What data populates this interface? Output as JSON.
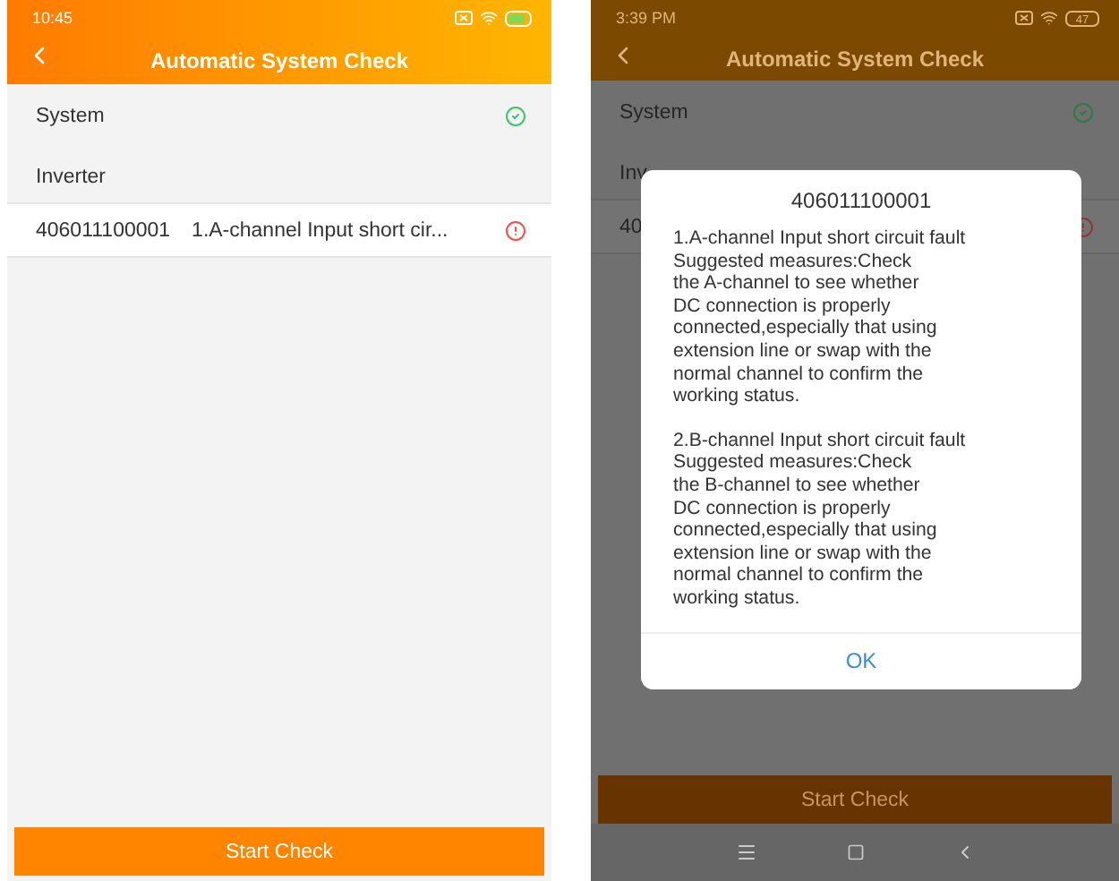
{
  "screens": [
    {
      "dimmed": false,
      "status_bar": {
        "time": "10:45"
      },
      "header": {
        "title": "Automatic System Check"
      },
      "rows": [
        {
          "kind": "status",
          "label": "System",
          "passed": true
        },
        {
          "kind": "section",
          "label": "Inverter"
        },
        {
          "kind": "fault",
          "code": "406011100001",
          "message": "1.A-channel Input short cir...",
          "passed": false
        }
      ],
      "button": "Start Check",
      "nav_bar": false
    },
    {
      "dimmed": true,
      "status_bar": {
        "time": "3:39 PM",
        "battery": "47"
      },
      "header": {
        "title": "Automatic System Check"
      },
      "rows": [
        {
          "kind": "status",
          "label": "System",
          "passed": true
        },
        {
          "kind": "section",
          "label": "Inv"
        },
        {
          "kind": "fault",
          "code": "40",
          "passed": false
        }
      ],
      "button": "Start Check",
      "nav_bar": true,
      "dialog": {
        "title": "406011100001",
        "paragraphs": [
          "1.A-channel Input short circuit fault\nSuggested measures:Check\nthe A-channel to see whether\nDC connection is properly\nconnected,especially that using\nextension line or swap with the\nnormal channel to confirm the\nworking status.",
          "2.B-channel Input short circuit fault\nSuggested measures:Check\nthe B-channel to see whether\nDC connection is properly\nconnected,especially that using\nextension line or swap with the\nnormal channel to confirm the\nworking status."
        ],
        "button": "OK"
      }
    }
  ]
}
